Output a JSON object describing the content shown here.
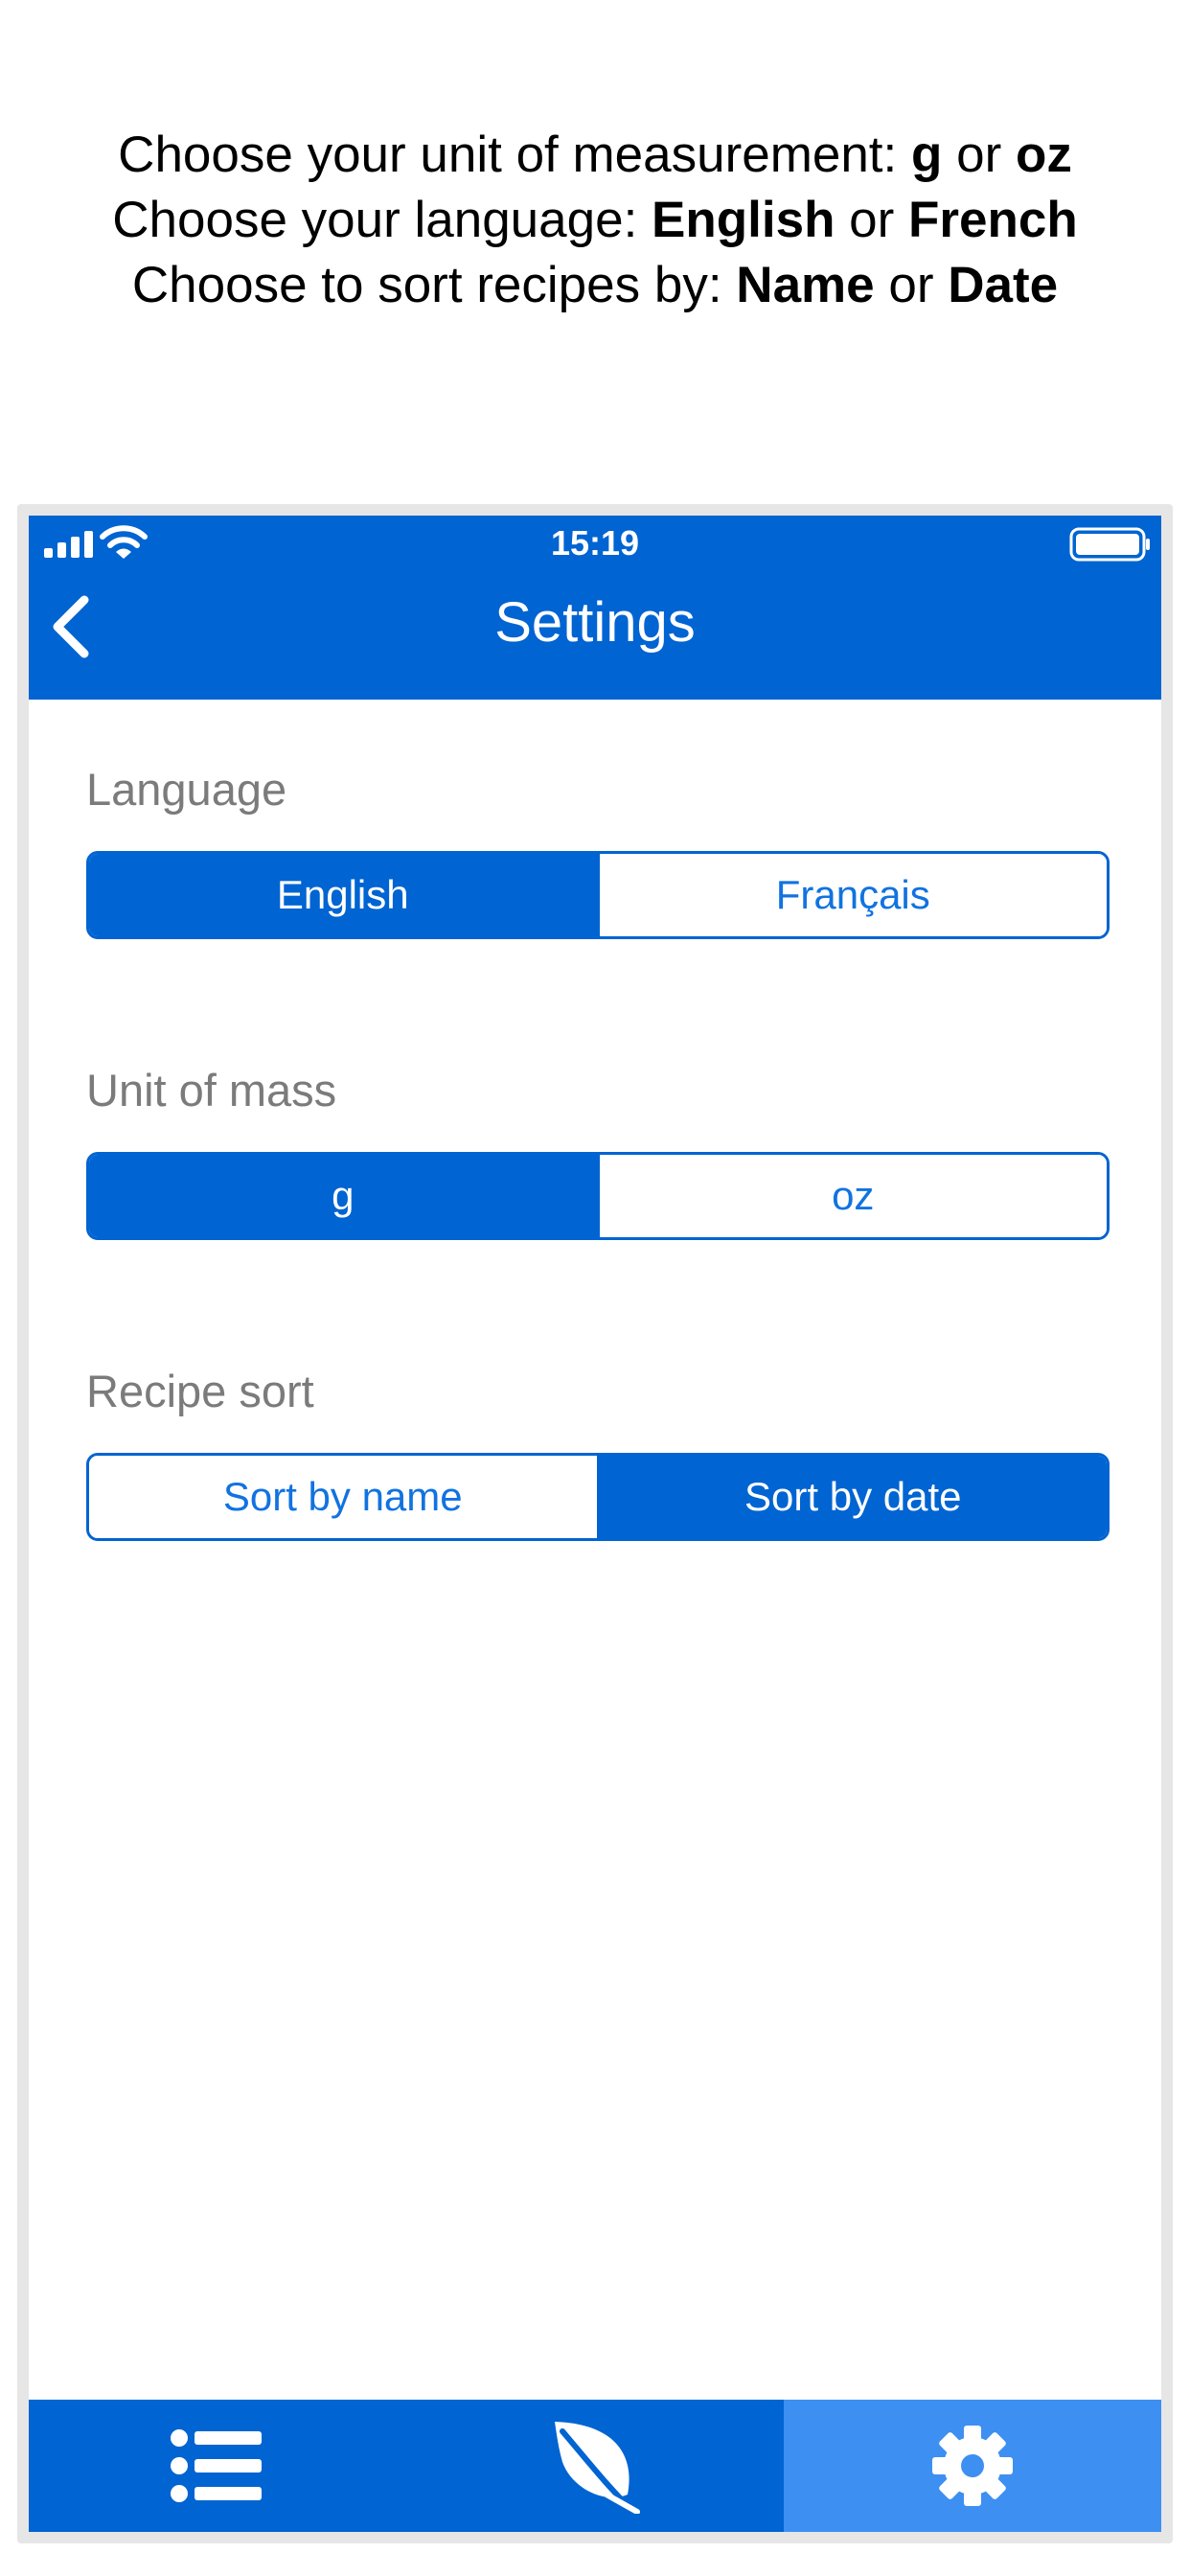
{
  "caption": {
    "line1": {
      "text": "Choose your unit of measurement: ",
      "opt1": "g",
      "or": " or ",
      "opt2": "oz"
    },
    "line2": {
      "text": "Choose your language: ",
      "opt1": "English",
      "or": " or ",
      "opt2": "French"
    },
    "line3": {
      "text": "Choose to sort recipes by: ",
      "opt1": "Name",
      "or": " or ",
      "opt2": "Date"
    }
  },
  "status_bar": {
    "time": "15:19"
  },
  "header": {
    "title": "Settings",
    "back_icon": "chevron-left-icon"
  },
  "settings": {
    "language": {
      "label": "Language",
      "options": [
        "English",
        "Français"
      ],
      "selected": "English"
    },
    "unit": {
      "label": "Unit of mass",
      "options": [
        "g",
        "oz"
      ],
      "selected": "g"
    },
    "sort": {
      "label": "Recipe sort",
      "options": [
        "Sort by name",
        "Sort by date"
      ],
      "selected": "Sort by date"
    }
  },
  "tabbar": {
    "tabs": [
      {
        "icon": "list-icon",
        "active": false
      },
      {
        "icon": "leaf-icon",
        "active": false
      },
      {
        "icon": "gear-icon",
        "active": true
      }
    ]
  },
  "colors": {
    "primary": "#0064d2",
    "active_tab": "#3d8ff2",
    "label_gray": "#7b7b7b",
    "frame": "#e6e6e6"
  }
}
